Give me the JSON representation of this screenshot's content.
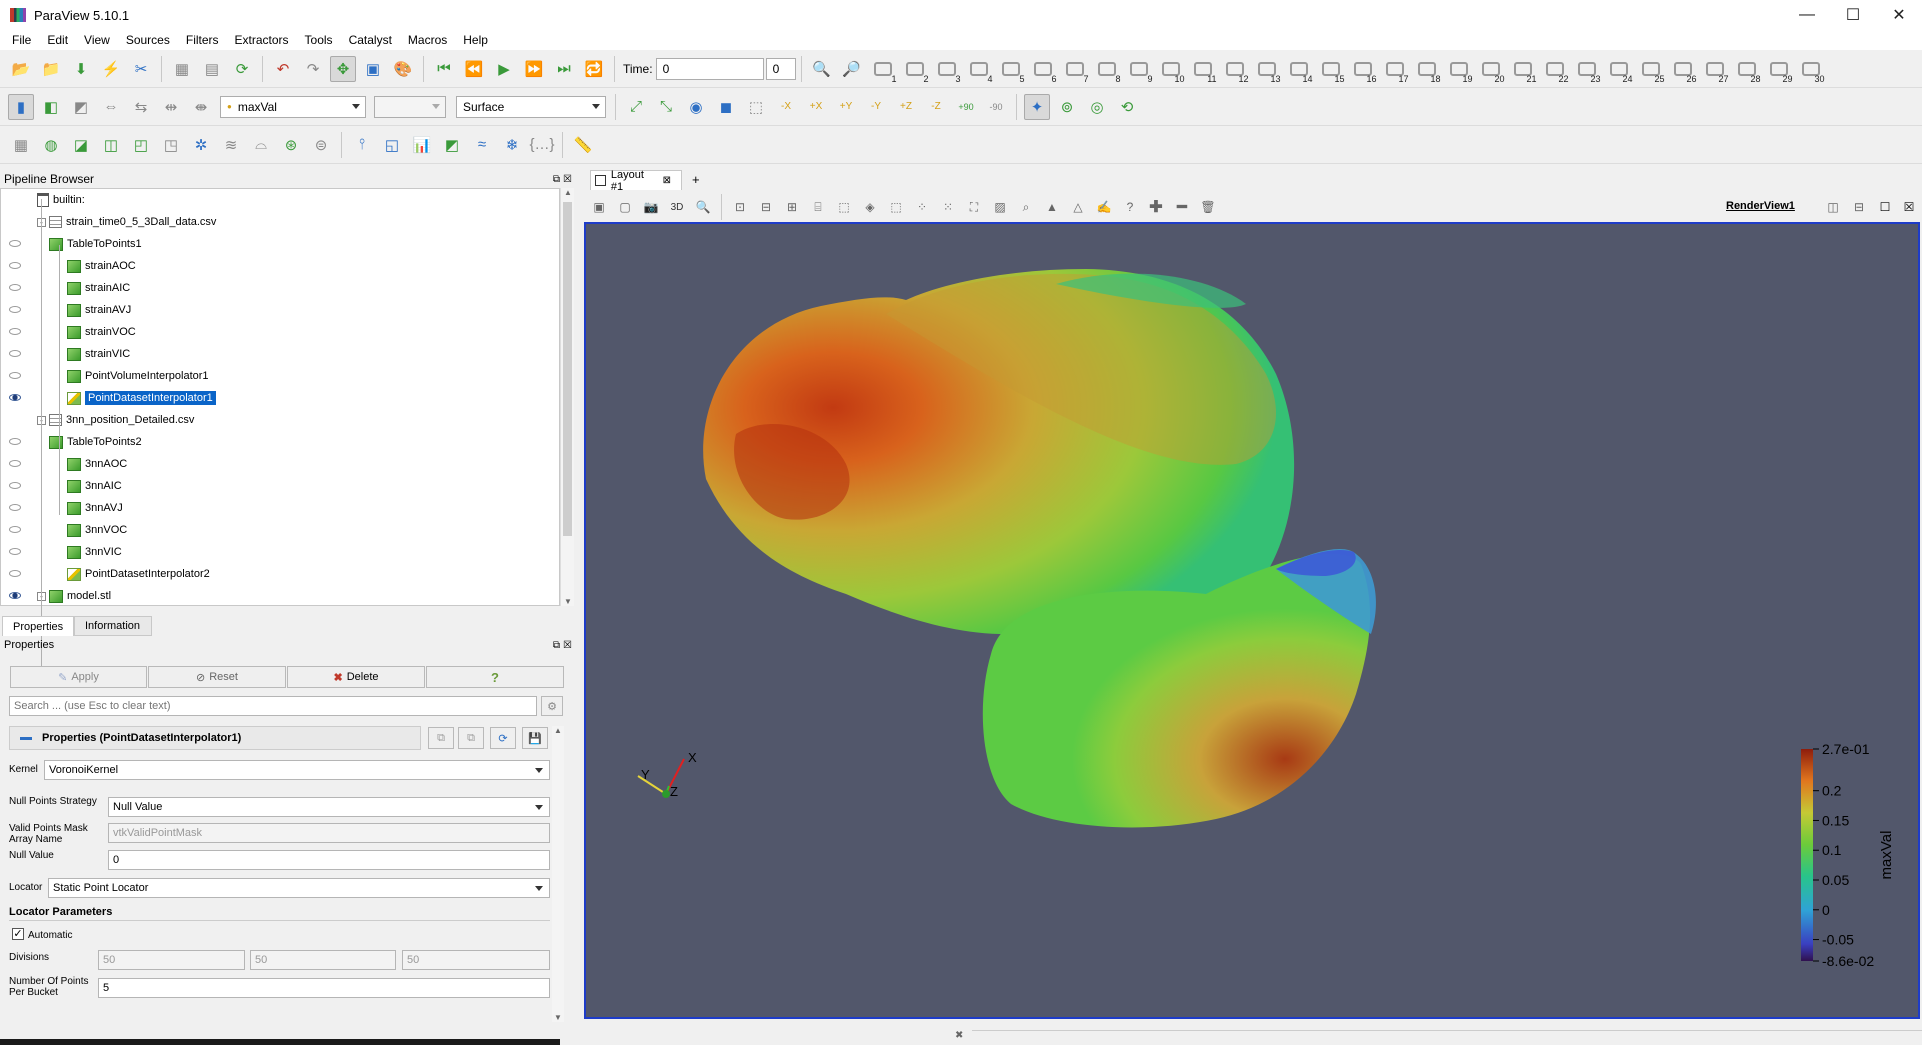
{
  "window": {
    "title": "ParaView 5.10.1",
    "controls": [
      "—",
      "☐",
      "✕"
    ]
  },
  "menu": [
    "File",
    "Edit",
    "View",
    "Sources",
    "Filters",
    "Extractors",
    "Tools",
    "Catalyst",
    "Macros",
    "Help"
  ],
  "toolbar1": {
    "time_label": "Time:",
    "time_value": "0",
    "time_index": "0",
    "camera_numbers": [
      "1",
      "2",
      "3",
      "4",
      "5",
      "6",
      "7",
      "8",
      "9",
      "10",
      "11",
      "12",
      "13",
      "14",
      "15",
      "16",
      "17",
      "18",
      "19",
      "20",
      "21",
      "22",
      "23",
      "24",
      "25",
      "26",
      "27",
      "28",
      "29",
      "30"
    ]
  },
  "toolbar2": {
    "array_value": "maxVal",
    "component_value": "",
    "representation_value": "Surface",
    "camera_rot_labels": [
      "-X",
      "+X",
      "+Y",
      "-Y",
      "+Z",
      "-Z",
      "+90",
      "-90"
    ]
  },
  "pipeline_browser": {
    "title": "Pipeline Browser",
    "root": "builtin:",
    "items": [
      {
        "label": "strain_time0_5_3Dall_data.csv",
        "depth": 1,
        "icon": "table",
        "eye": "none",
        "expander": "-"
      },
      {
        "label": "TableToPoints1",
        "depth": 1,
        "icon": "cube",
        "eye": "off"
      },
      {
        "label": "strainAOC",
        "depth": 2,
        "icon": "cube",
        "eye": "off"
      },
      {
        "label": "strainAIC",
        "depth": 2,
        "icon": "cube",
        "eye": "off"
      },
      {
        "label": "strainAVJ",
        "depth": 2,
        "icon": "cube",
        "eye": "off"
      },
      {
        "label": "strainVOC",
        "depth": 2,
        "icon": "cube",
        "eye": "off"
      },
      {
        "label": "strainVIC",
        "depth": 2,
        "icon": "cube",
        "eye": "off"
      },
      {
        "label": "PointVolumeInterpolator1",
        "depth": 2,
        "icon": "cube",
        "eye": "off"
      },
      {
        "label": "PointDatasetInterpolator1",
        "depth": 2,
        "icon": "pen",
        "eye": "on",
        "selected": true
      },
      {
        "label": "3nn_position_Detailed.csv",
        "depth": 1,
        "icon": "table",
        "eye": "none",
        "expander": "-"
      },
      {
        "label": "TableToPoints2",
        "depth": 1,
        "icon": "cube",
        "eye": "off"
      },
      {
        "label": "3nnAOC",
        "depth": 2,
        "icon": "cube",
        "eye": "off"
      },
      {
        "label": "3nnAIC",
        "depth": 2,
        "icon": "cube",
        "eye": "off"
      },
      {
        "label": "3nnAVJ",
        "depth": 2,
        "icon": "cube",
        "eye": "off"
      },
      {
        "label": "3nnVOC",
        "depth": 2,
        "icon": "cube",
        "eye": "off"
      },
      {
        "label": "3nnVIC",
        "depth": 2,
        "icon": "cube",
        "eye": "off"
      },
      {
        "label": "PointDatasetInterpolator2",
        "depth": 2,
        "icon": "pen",
        "eye": "off"
      },
      {
        "label": "model.stl",
        "depth": 1,
        "icon": "cube",
        "eye": "on",
        "expander": "-"
      }
    ]
  },
  "panel_tabs": [
    "Properties",
    "Information"
  ],
  "properties": {
    "title": "Properties",
    "apply": "Apply",
    "reset": "Reset",
    "delete": "Delete",
    "help": "?",
    "search_placeholder": "Search ... (use Esc to clear text)",
    "section_title": "Properties (PointDatasetInterpolator1)",
    "kernel_label": "Kernel",
    "kernel_value": "VoronoiKernel",
    "null_strategy_label": "Null Points Strategy",
    "null_strategy_value": "Null Value",
    "valid_mask_label_1": "Valid Points Mask",
    "valid_mask_label_2": "Array Name",
    "valid_mask_value": "vtkValidPointMask",
    "null_value_label": "Null Value",
    "null_value": "0",
    "locator_label": "Locator",
    "locator_value": "Static Point Locator",
    "locator_params": "Locator Parameters",
    "automatic_label": "Automatic",
    "automatic_checked": true,
    "divisions_label": "Divisions",
    "divisions": [
      "50",
      "50",
      "50"
    ],
    "points_bucket_label_1": "Number Of Points",
    "points_bucket_label_2": "Per Bucket",
    "points_bucket_value": "5"
  },
  "view": {
    "tab_label": "Layout #1",
    "add_tab": "+",
    "mode_3d": "3D",
    "render_view_name": "RenderView1",
    "background": "#52576b"
  },
  "colorbar": {
    "title": "maxVal",
    "labels": [
      "2.7e-01",
      "0.2",
      "0.15",
      "0.1",
      "0.05",
      "0",
      "-0.05",
      "-8.6e-02"
    ],
    "min": -0.086,
    "max": 0.27,
    "ticks": [
      0.27,
      0.2,
      0.15,
      0.1,
      0.05,
      0,
      -0.05,
      -0.086
    ]
  },
  "axes": {
    "x": "X",
    "y": "Y",
    "z": "Z"
  }
}
